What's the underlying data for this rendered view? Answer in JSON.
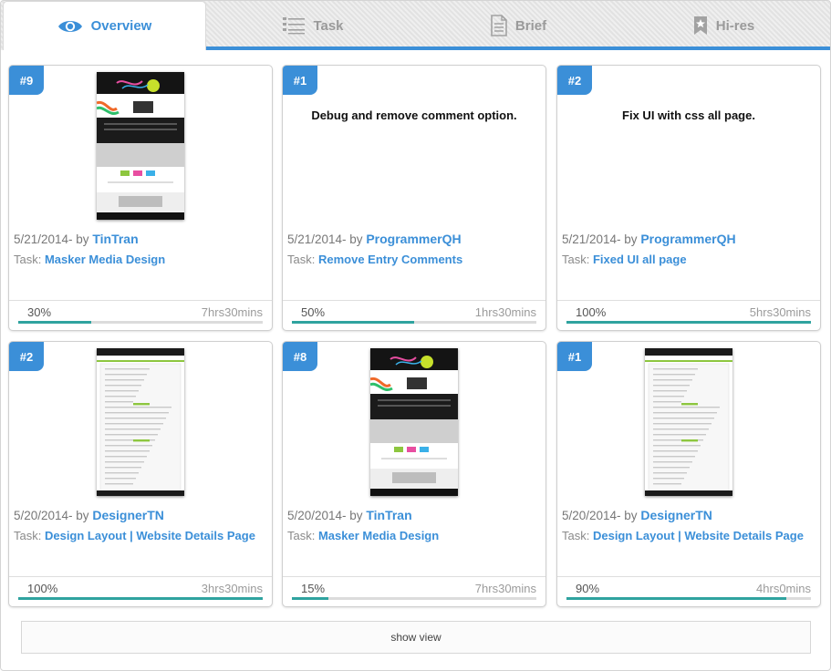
{
  "tabs": [
    {
      "label": "Overview",
      "icon": "eye-icon",
      "active": true
    },
    {
      "label": "Task",
      "icon": "list-icon"
    },
    {
      "label": "Brief",
      "icon": "document-icon"
    },
    {
      "label": "Hi-res",
      "icon": "bookmark-star-icon"
    }
  ],
  "colors": {
    "accent": "#3b8fd8",
    "progress": "#2fa39f"
  },
  "cards": [
    {
      "badge": "#9",
      "has_thumb": true,
      "thumb_style": "dark",
      "date": "5/21/2014- by ",
      "author": "TinTran",
      "task_prefix": "Task: ",
      "task": "Masker Media Design",
      "percent": "30%",
      "progress": 0.3,
      "time": "7hrs30mins"
    },
    {
      "badge": "#1",
      "has_thumb": false,
      "title": "Debug and remove comment option.",
      "date": "5/21/2014- by ",
      "author": "ProgrammerQH",
      "task_prefix": "Task: ",
      "task": "Remove Entry Comments",
      "percent": "50%",
      "progress": 0.5,
      "time": "1hrs30mins"
    },
    {
      "badge": "#2",
      "has_thumb": false,
      "title": "Fix UI with css all page.",
      "date": "5/21/2014- by ",
      "author": "ProgrammerQH",
      "task_prefix": "Task: ",
      "task": "Fixed UI all page",
      "percent": "100%",
      "progress": 1.0,
      "time": "5hrs30mins"
    },
    {
      "badge": "#2",
      "has_thumb": true,
      "thumb_style": "light",
      "date": "5/20/2014- by ",
      "author": "DesignerTN",
      "task_prefix": "Task: ",
      "task": "Design Layout | Website Details Page",
      "percent": "100%",
      "progress": 1.0,
      "time": "3hrs30mins"
    },
    {
      "badge": "#8",
      "has_thumb": true,
      "thumb_style": "dark",
      "date": "5/20/2014- by ",
      "author": "TinTran",
      "task_prefix": "Task: ",
      "task": "Masker Media Design",
      "percent": "15%",
      "progress": 0.15,
      "time": "7hrs30mins"
    },
    {
      "badge": "#1",
      "has_thumb": true,
      "thumb_style": "light",
      "date": "5/20/2014- by ",
      "author": "DesignerTN",
      "task_prefix": "Task: ",
      "task": "Design Layout | Website Details Page",
      "percent": "90%",
      "progress": 0.9,
      "time": "4hrs0mins"
    }
  ],
  "show_view_label": "show view"
}
